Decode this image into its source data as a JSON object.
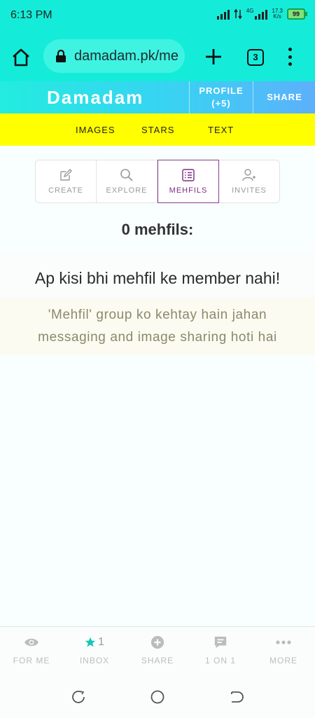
{
  "status": {
    "time": "6:13 PM",
    "network": "4G",
    "speed": "17.3",
    "speed_unit": "K/s",
    "battery": "99"
  },
  "browser": {
    "url": "damadam.pk/me",
    "tab_count": "3"
  },
  "header": {
    "brand": "Damadam",
    "profile_label": "PROFILE",
    "profile_count": "(+5)",
    "share_label": "SHARE"
  },
  "yellow_nav": {
    "images": "IMAGES",
    "stars": "STARS",
    "text": "TEXT"
  },
  "tabs": {
    "create": "CREATE",
    "explore": "EXPLORE",
    "mehfils": "MEHFILS",
    "invites": "INVITES"
  },
  "content": {
    "count": "0 mehfils:",
    "message": "Ap kisi bhi mehfil ke member nahi!",
    "info": "'Mehfil' group ko kehtay hain jahan messaging and image sharing hoti hai"
  },
  "bottom_nav": {
    "for_me": "FOR ME",
    "inbox": "INBOX",
    "inbox_count": "1",
    "share": "SHARE",
    "one_on_one": "1 ON 1",
    "more": "MORE"
  },
  "colors": {
    "teal": "#14ecd9",
    "yellow": "#ffff00",
    "accent": "#7a2d80",
    "star": "#14c7b5"
  }
}
